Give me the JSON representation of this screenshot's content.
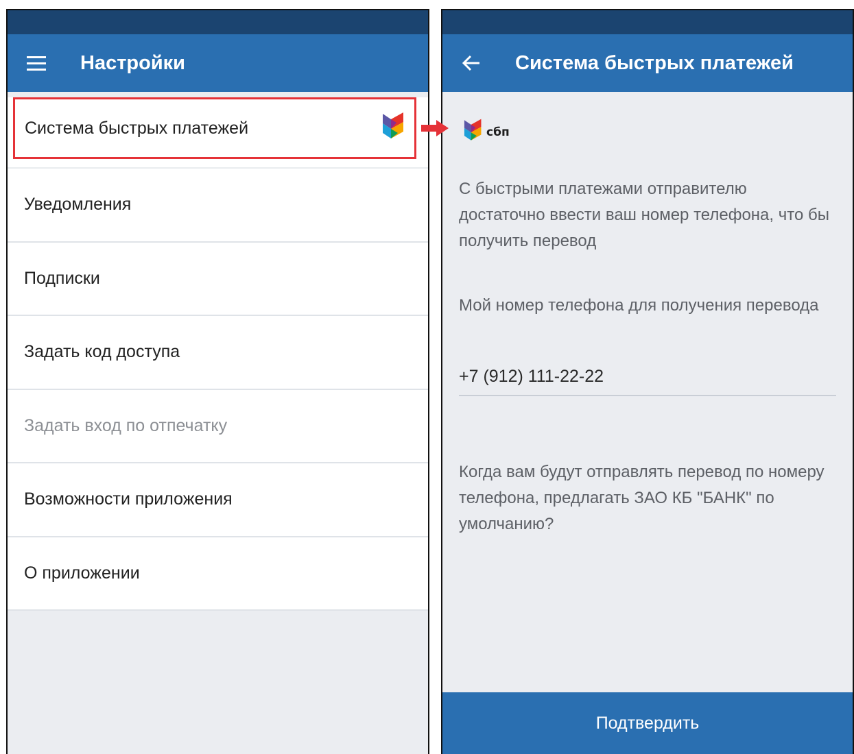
{
  "left": {
    "title": "Настройки",
    "items": [
      {
        "label": "Система быстрых платежей"
      },
      {
        "label": "Уведомления"
      },
      {
        "label": "Подписки"
      },
      {
        "label": "Задать код доступа"
      },
      {
        "label": "Задать вход по отпечатку"
      },
      {
        "label": "Возможности приложения"
      },
      {
        "label": "О приложении"
      }
    ]
  },
  "right": {
    "title": "Система быстрых платежей",
    "logo_text": "сбп",
    "description": "С быстрыми платежами отправителю достаточно ввести ваш номер телефона, что бы получить перевод",
    "phone_label": "Мой номер телефона для получения перевода",
    "phone_value": "+7 (912) 111-22-22",
    "question": "Когда вам будут отправлять перевод по номеру телефона, предлагать ЗАО КБ \"БАНК\" по умолчанию?",
    "confirm_label": "Подтвердить"
  },
  "colors": {
    "statusbar": "#1b4470",
    "appbar": "#2a6fb1",
    "highlight": "#e53238",
    "background": "#ebedf1"
  },
  "icons": [
    "menu-icon",
    "back-arrow-icon",
    "sbp-logo-icon",
    "red-arrow-icon"
  ]
}
